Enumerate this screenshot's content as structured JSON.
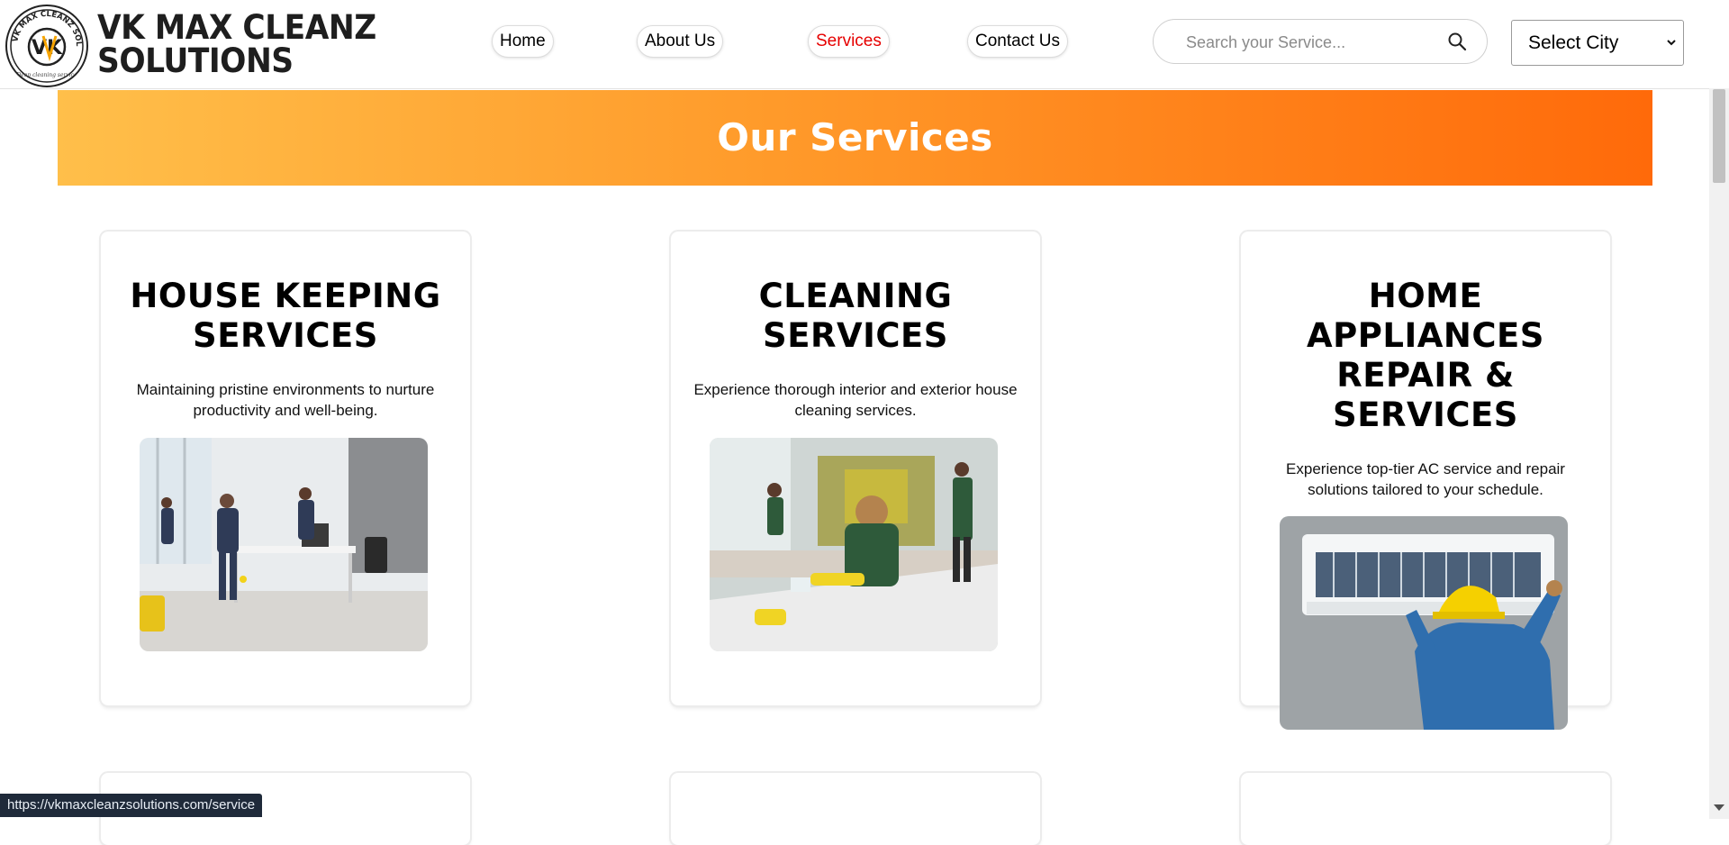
{
  "header": {
    "brand_line1": "VK MAX CLEANZ",
    "brand_line2": "SOLUTIONS",
    "logo_ring_text": "VK MAX CLEANZ SOLUTIONS",
    "logo_monogram": "VK",
    "logo_tagline": "Deep cleaning service",
    "nav": [
      {
        "label": "Home",
        "active": false
      },
      {
        "label": "About Us",
        "active": false
      },
      {
        "label": "Services",
        "active": true
      },
      {
        "label": "Contact Us",
        "active": false
      }
    ],
    "search_placeholder": "Search your Service...",
    "search_value": "",
    "city_select": "Select City"
  },
  "banner": {
    "title": "Our Services"
  },
  "services": [
    {
      "title": "HOUSE KEEPING SERVICES",
      "description": "Maintaining pristine environments to nurture productivity and well-being.",
      "image": "office-cleaning-team-photo"
    },
    {
      "title": "CLEANING SERVICES",
      "description": "Experience thorough interior and exterior house cleaning services.",
      "image": "house-cleaning-photo"
    },
    {
      "title": "HOME APPLIANCES REPAIR & SERVICES",
      "description": "Experience top-tier AC service and repair solutions tailored to your schedule.",
      "image": "ac-repair-technician-photo"
    }
  ],
  "status_url": "https://vkmaxcleanzsolutions.com/service",
  "colors": {
    "accent_active": "#e60000",
    "banner_gradient_start": "#ffbf4a",
    "banner_gradient_end": "#ff6a0a",
    "status_bar": "#1f2a3a"
  }
}
